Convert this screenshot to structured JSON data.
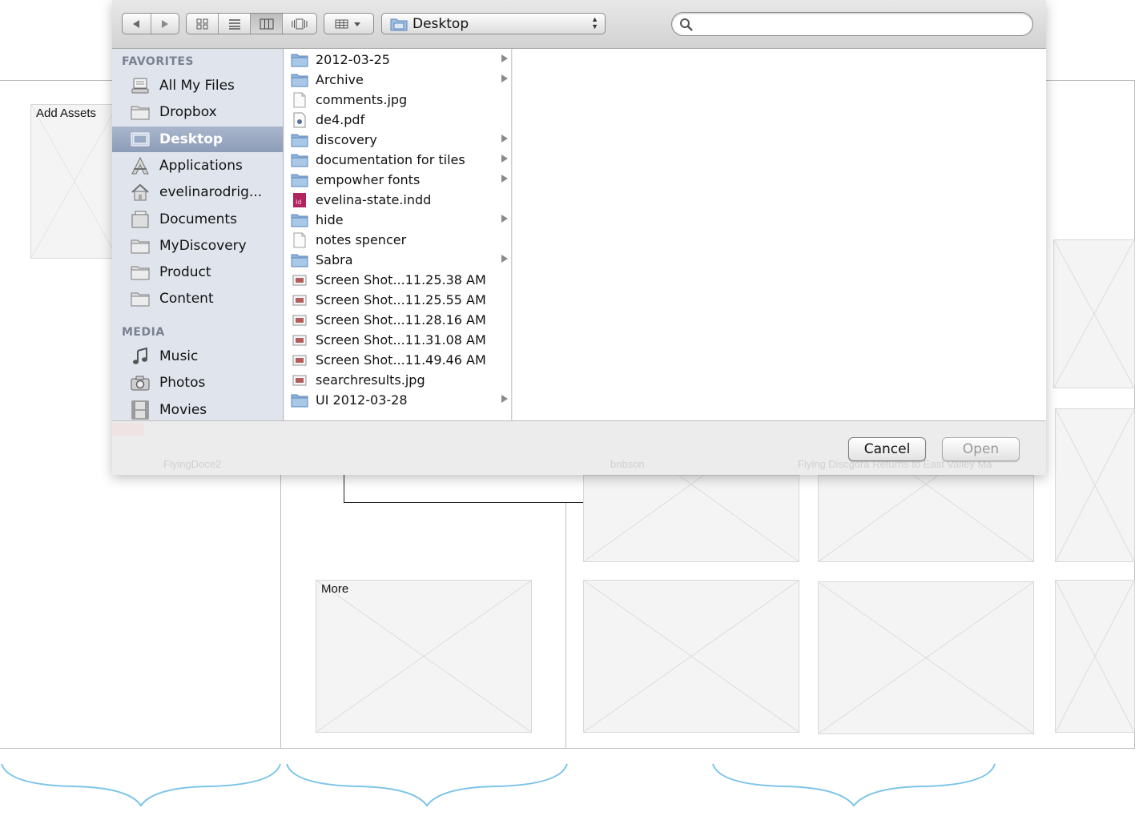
{
  "background": {
    "add_assets_label": "Add Assets",
    "more_label": "More"
  },
  "dialog": {
    "toolbar": {
      "nav_back": "back",
      "nav_forward": "forward",
      "location": "Desktop",
      "search_placeholder": ""
    },
    "sidebar": {
      "favorites_header": "FAVORITES",
      "favorites": [
        {
          "label": "All My Files",
          "icon": "all-files-icon"
        },
        {
          "label": "Dropbox",
          "icon": "folder-icon"
        },
        {
          "label": "Desktop",
          "icon": "desktop-icon",
          "selected": true
        },
        {
          "label": "Applications",
          "icon": "applications-icon"
        },
        {
          "label": "evelinarodrig...",
          "icon": "home-icon"
        },
        {
          "label": "Documents",
          "icon": "documents-icon"
        },
        {
          "label": "MyDiscovery",
          "icon": "folder-icon"
        },
        {
          "label": "Product",
          "icon": "folder-icon"
        },
        {
          "label": "Content",
          "icon": "folder-icon"
        }
      ],
      "media_header": "MEDIA",
      "media": [
        {
          "label": "Music",
          "icon": "music-icon"
        },
        {
          "label": "Photos",
          "icon": "camera-icon"
        },
        {
          "label": "Movies",
          "icon": "film-icon"
        }
      ]
    },
    "files": [
      {
        "name": "2012-03-25",
        "kind": "folder"
      },
      {
        "name": "Archive",
        "kind": "folder"
      },
      {
        "name": "comments.jpg",
        "kind": "doc"
      },
      {
        "name": "de4.pdf",
        "kind": "pdf"
      },
      {
        "name": "discovery",
        "kind": "folder"
      },
      {
        "name": "documentation for tiles",
        "kind": "folder"
      },
      {
        "name": "empowher fonts",
        "kind": "folder"
      },
      {
        "name": "evelina-state.indd",
        "kind": "indd"
      },
      {
        "name": "hide",
        "kind": "folder"
      },
      {
        "name": "notes spencer",
        "kind": "doc"
      },
      {
        "name": "Sabra",
        "kind": "folder"
      },
      {
        "name": "Screen Shot...11.25.38 AM",
        "kind": "image"
      },
      {
        "name": "Screen Shot...11.25.55 AM",
        "kind": "image"
      },
      {
        "name": "Screen Shot...11.28.16 AM",
        "kind": "image"
      },
      {
        "name": "Screen Shot...11.31.08 AM",
        "kind": "image"
      },
      {
        "name": "Screen Shot...11.49.46 AM",
        "kind": "image"
      },
      {
        "name": "searchresults.jpg",
        "kind": "image"
      },
      {
        "name": "UI 2012-03-28",
        "kind": "folder"
      }
    ],
    "buttons": {
      "cancel": "Cancel",
      "open": "Open"
    },
    "ghost_text": {
      "a": "FlyingDoce2",
      "b": "bnbson",
      "c": "Flying Discgora Returns to East Valley Ma"
    }
  },
  "colors": {
    "selection": "#8d9cb8",
    "sidebar_bg": "#e0e5ed",
    "folder_blue": "#8fb6de",
    "brace_blue": "#7cc4e8"
  }
}
